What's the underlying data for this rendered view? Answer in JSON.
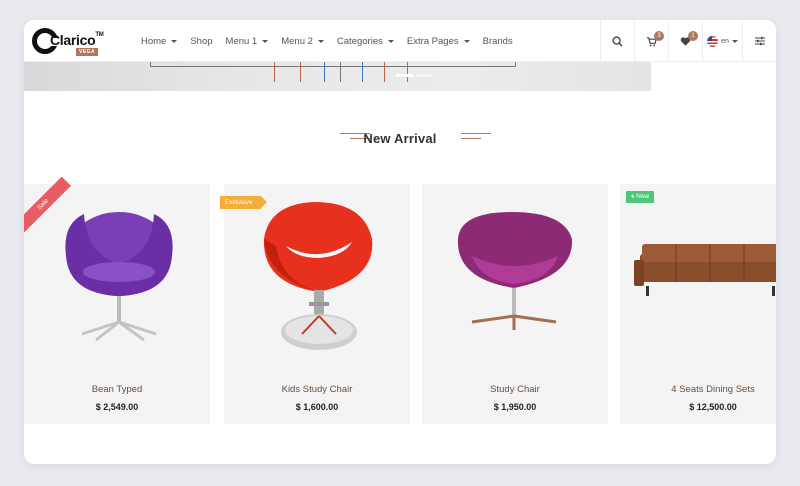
{
  "brand": {
    "name": "Clarico",
    "trademark": "TM",
    "sub": "VEGA"
  },
  "nav": {
    "items": [
      {
        "label": "Home",
        "dropdown": true
      },
      {
        "label": "Shop",
        "dropdown": false
      },
      {
        "label": "Menu 1",
        "dropdown": true
      },
      {
        "label": "Menu 2",
        "dropdown": true
      },
      {
        "label": "Categories",
        "dropdown": true
      },
      {
        "label": "Extra Pages",
        "dropdown": true
      },
      {
        "label": "Brands",
        "dropdown": false
      }
    ]
  },
  "header_actions": {
    "cart_count": "3",
    "wishlist_count": "1",
    "language": "en"
  },
  "section": {
    "title": "New Arrival"
  },
  "products": [
    {
      "name": "Bean Typed",
      "price": "$ 2,549.00",
      "label": "Sale",
      "label_color": "#e85c66",
      "chair_color": "#7a3fb6"
    },
    {
      "name": "Kids Study Chair",
      "price": "$ 1,600.00",
      "label": "Exclusive",
      "label_color": "#f5ad3a",
      "chair_color": "#e8301f"
    },
    {
      "name": "Study Chair",
      "price": "$ 1,950.00",
      "label": "",
      "label_color": "",
      "chair_color": "#8c2a76"
    },
    {
      "name": "4 Seats Dining Sets",
      "price": "$ 12,500.00",
      "label": "New",
      "label_color": "#4cc679",
      "chair_color": "#8b4e2d"
    }
  ],
  "colors": {
    "accent": "#b0775f",
    "card_bg": "#f4f4f4"
  }
}
